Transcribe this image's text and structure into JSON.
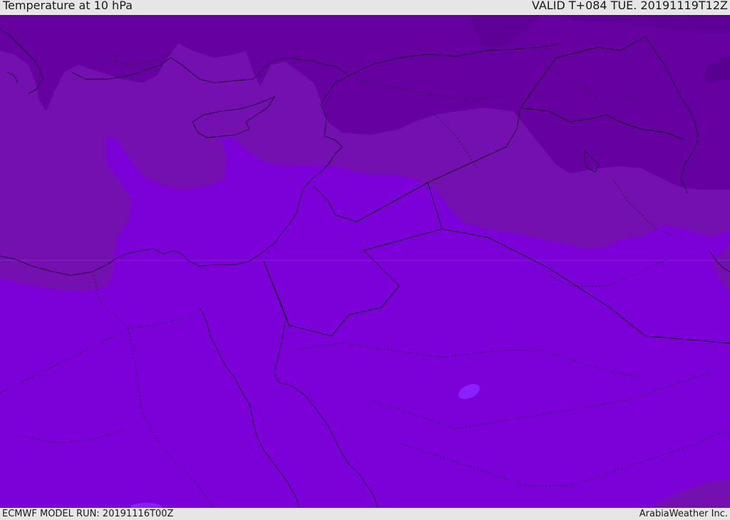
{
  "header": {
    "title": "Temperature at 10 hPa",
    "valid_time": "VALID T+084 TUE. 20191119T12Z"
  },
  "footer": {
    "model_run": "ECMWF MODEL RUN: 20191116T00Z",
    "credit": "ArabiaWeather Inc."
  },
  "colors": {
    "darkest": "#5a0090",
    "dark": "#6600a0",
    "mid": "#7510b0",
    "base": "#7c00d8",
    "bright": "#8a20ff",
    "border": "#1a0033"
  }
}
